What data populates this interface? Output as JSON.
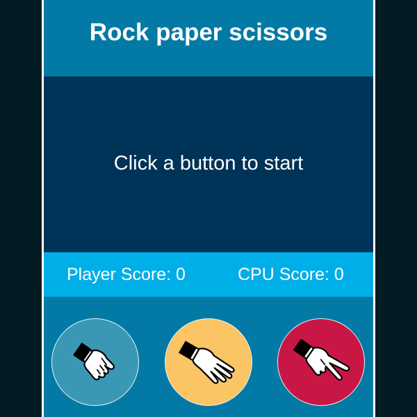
{
  "title": "Rock paper scissors",
  "message": "Click a button to start",
  "scores": {
    "player": "Player Score: 0",
    "cpu": "CPU Score: 0"
  },
  "colors": {
    "page_background": "#031c24",
    "app_border": "#ffffff",
    "app_background": "#027aa5",
    "message_panel": "#003358",
    "score_bar": "#00aee8"
  },
  "choices": [
    {
      "id": "rock",
      "icon": "rock-hand-icon",
      "color": "#3b98b5"
    },
    {
      "id": "paper",
      "icon": "paper-hand-icon",
      "color": "#fbc464"
    },
    {
      "id": "scissors",
      "icon": "scissors-hand-icon",
      "color": "#c91745"
    }
  ]
}
